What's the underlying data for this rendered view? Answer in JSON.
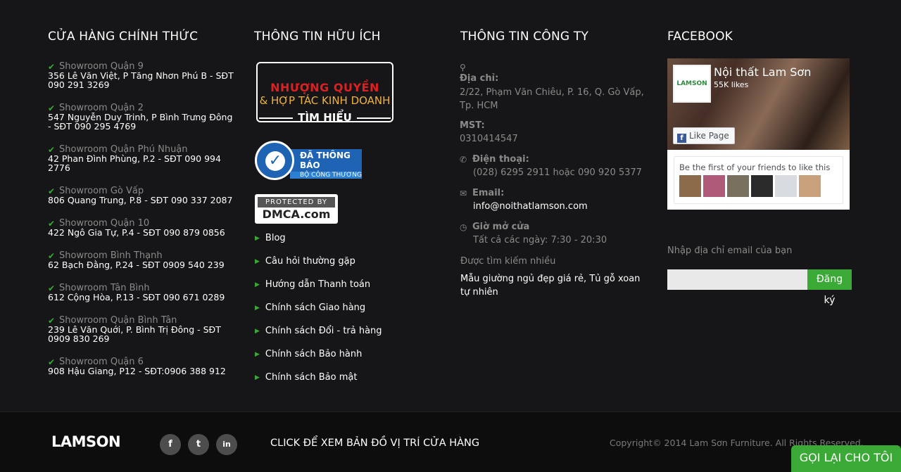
{
  "columns": {
    "stores_title": "CỬA HÀNG CHÍNH THỨC",
    "useful_title": "THÔNG TIN HỮU ÍCH",
    "company_title": "THÔNG TIN CÔNG TY",
    "facebook_title": "FACEBOOK"
  },
  "stores": [
    {
      "name": "Showroom Quận 9",
      "address": "356 Lê Văn Việt, P Tăng Nhơn Phú B - SĐT 090 291 3269"
    },
    {
      "name": "Showroom Quận 2",
      "address": "547 Nguyễn Duy Trinh, P Bình Trưng Đông - SĐT 090 295 4769"
    },
    {
      "name": "Showroom Quận Phú Nhuận",
      "address": "42 Phan Đình Phùng, P.2 - SĐT 090 994 2776"
    },
    {
      "name": "Showroom Gò Vấp",
      "address": "806 Quang Trung, P.8 - SĐT 090 337 2087"
    },
    {
      "name": "Showroom Quận 10",
      "address": "422 Ngô Gia Tự, P.4 - SĐT 090 879 0856"
    },
    {
      "name": "Showroom Bình Thạnh",
      "address": "62 Bạch Đằng, P.24 - SĐT 0909 540 239"
    },
    {
      "name": "Showroom Tân Bình",
      "address": "612 Cộng Hòa, P.13 - SĐT 090 671 0289"
    },
    {
      "name": "Showroom Quận Bình Tân",
      "address": "239 Lê Văn Quới, P. Bình Trị Đông - SĐT 0909 830 269"
    },
    {
      "name": "Showroom Quận 6",
      "address": "908 Hậu Giang, P12 - SĐT:0906 388 912"
    }
  ],
  "franchise": {
    "line1": "NHƯỢNG QUYỀN",
    "line2": "& HỢP TÁC KINH DOANH",
    "line3": "TÌM HIỂU"
  },
  "notice_badge": {
    "main": "ĐÃ THÔNG BÁO",
    "sub": "BỘ CÔNG THƯƠNG"
  },
  "dmca": {
    "top": "PROTECTED BY",
    "bottom": "DMCA.com"
  },
  "links": [
    "Blog",
    "Câu hỏi thường gặp",
    "Hướng dẫn Thanh toán",
    "Chính sách Giao hàng",
    "Chính sách Đổi - trả hàng",
    "Chính sách Bảo hành",
    "Chính sách Bảo mật"
  ],
  "company": {
    "address_label": "Địa chỉ:",
    "address_value": "2/22, Phạm Văn Chiêu, P. 16, Q. Gò Vấp, Tp. HCM",
    "mst_label": "MST:",
    "mst_value": "0310414547",
    "phone_label": "Điện thoại:",
    "phone_value": "(028) 6295 2911 hoặc 090 920 5377",
    "email_label": "Email:",
    "email_value": "info@noithatlamson.com",
    "hours_label": "Giờ mở cửa",
    "hours_value": "Tất cả các ngày: 7:30 - 20:30",
    "searched_label": "Được tìm kiếm nhiều",
    "keyword1": "Mẫu giường ngủ đẹp giá rẻ",
    "keyword_sep": ", ",
    "keyword2": "Tủ gỗ xoan tự nhiên"
  },
  "facebook": {
    "page_name": "Nội thất Lam Sơn",
    "likes": "55K likes",
    "like_button": "Like Page",
    "friends_text": "Be the first of your friends to like this",
    "logo_text": "LAMSON"
  },
  "newsletter": {
    "label": "Nhập địa chỉ email của bạn",
    "button_line1": "Đăng",
    "button_line2": "ký"
  },
  "bottom": {
    "logo": "LAMSON",
    "map_link": "CLICK ĐỂ XEM BẢN ĐỒ VỊ TRÍ CỬA HÀNG",
    "copyright": "Copyright© 2014 Lam Sơn Furniture. All Rights Reserved.",
    "call_button": "GỌI LẠI CHO TÔI"
  },
  "colors": {
    "background": "#161618",
    "accent_green": "#3aa935",
    "muted_text": "#8a8a8a"
  }
}
